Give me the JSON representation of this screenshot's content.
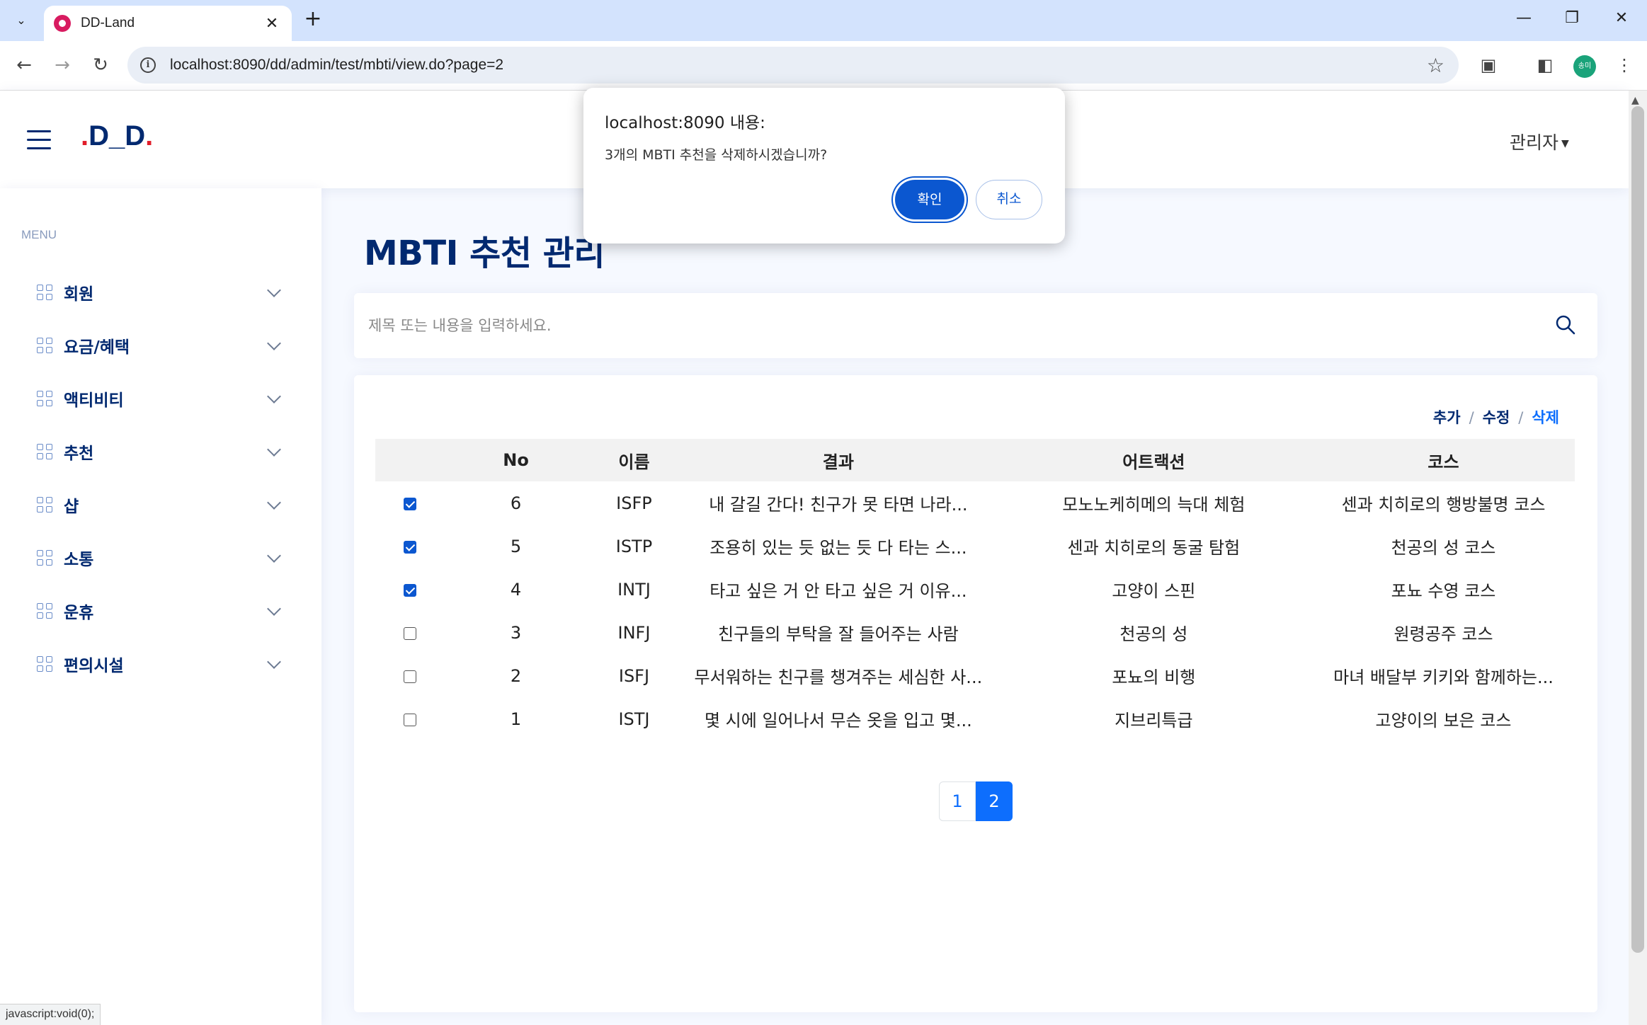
{
  "browser": {
    "tab_title": "DD-Land",
    "url": "localhost:8090/dd/admin/test/mbti/view.do?page=2",
    "profile_label": "송미",
    "status_text": "javascript:void(0);"
  },
  "header": {
    "logo_prefix": ".",
    "logo_main": "D_D",
    "logo_suffix": ".",
    "admin_label": "관리자"
  },
  "sidebar": {
    "heading": "MENU",
    "items": [
      {
        "label": "회원"
      },
      {
        "label": "요금/혜택"
      },
      {
        "label": "액티비티"
      },
      {
        "label": "추천"
      },
      {
        "label": "샵"
      },
      {
        "label": "소통"
      },
      {
        "label": "운휴"
      },
      {
        "label": "편의시설"
      }
    ]
  },
  "main": {
    "title": "MBTI 추천 관리",
    "search_placeholder": "제목 또는 내용을 입력하세요.",
    "actions": {
      "add": "추가",
      "edit": "수정",
      "delete": "삭제",
      "sep": "/"
    },
    "columns": [
      "No",
      "이름",
      "결과",
      "어트랙션",
      "코스"
    ],
    "rows": [
      {
        "checked": true,
        "no": "6",
        "name": "ISFP",
        "result": "내 갈길 간다! 친구가 못 타면 나라...",
        "attraction": "모노노케히메의 늑대 체험",
        "course": "센과 치히로의 행방불명 코스"
      },
      {
        "checked": true,
        "no": "5",
        "name": "ISTP",
        "result": "조용히 있는 듯 없는 듯 다 타는 스...",
        "attraction": "센과 치히로의 동굴 탐험",
        "course": "천공의 성 코스"
      },
      {
        "checked": true,
        "no": "4",
        "name": "INTJ",
        "result": "타고 싶은 거 안 타고 싶은 거 이유...",
        "attraction": "고양이 스핀",
        "course": "포뇨 수영 코스"
      },
      {
        "checked": false,
        "no": "3",
        "name": "INFJ",
        "result": "친구들의 부탁을 잘 들어주는 사람",
        "attraction": "천공의 성",
        "course": "원령공주 코스"
      },
      {
        "checked": false,
        "no": "2",
        "name": "ISFJ",
        "result": "무서워하는 친구를 챙겨주는 세심한 사...",
        "attraction": "포뇨의 비행",
        "course": "마녀 배달부 키키와 함께하는..."
      },
      {
        "checked": false,
        "no": "1",
        "name": "ISTJ",
        "result": "몇 시에 일어나서 무슨 옷을 입고 몇...",
        "attraction": "지브리특급",
        "course": "고양이의 보은 코스"
      }
    ],
    "pagination": {
      "pages": [
        "1",
        "2"
      ],
      "current": "2"
    }
  },
  "dialog": {
    "title": "localhost:8090 내용:",
    "message": "3개의 MBTI 추천을 삭제하시겠습니까?",
    "ok_label": "확인",
    "cancel_label": "취소"
  },
  "colors": {
    "brand_navy": "#012970",
    "primary_blue": "#0d6efd",
    "dialog_blue": "#0b57d0",
    "logo_dot_red": "#e11d2a"
  }
}
